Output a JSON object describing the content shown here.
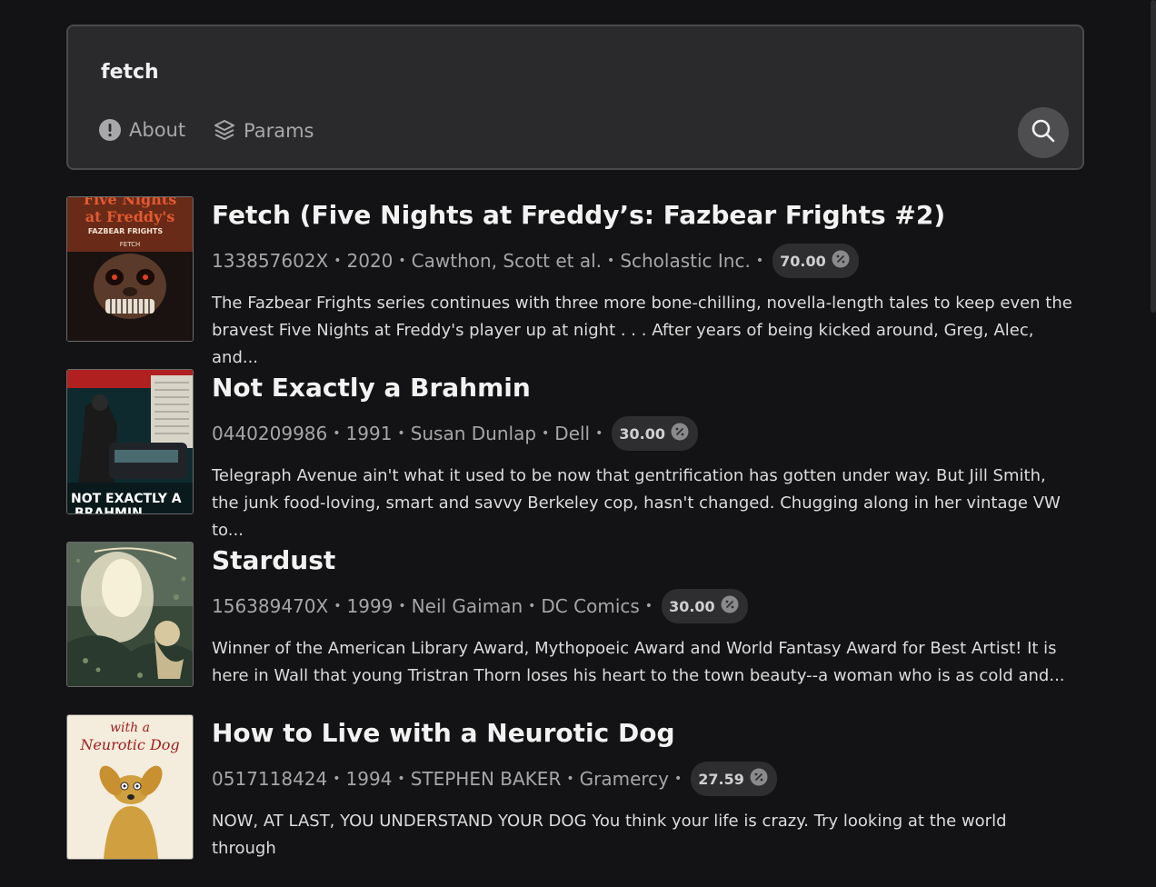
{
  "search": {
    "query": "fetch",
    "about_label": "About",
    "params_label": "Params"
  },
  "icons": {
    "about": "alert-circle-icon",
    "params": "layers-icon",
    "search": "search-icon",
    "price": "discount-badge-icon"
  },
  "results": [
    {
      "title": "Fetch (Five Nights at Freddy’s: Fazbear Frights #2)",
      "isbn": "133857602X",
      "year": "2020",
      "author": "Cawthon, Scott et al.",
      "publisher": "Scholastic Inc.",
      "price": "70.00",
      "description": "The Fazbear Frights series continues with three more bone-chilling, novella-length tales to keep even the bravest Five Nights at Freddy's player up at night . . . After years of being kicked around, Greg, Alec, and...",
      "cover_text": [
        "Five Nights",
        "at Freddy's",
        "FAZBEAR FRIGHTS",
        "FETCH"
      ]
    },
    {
      "title": "Not Exactly a Brahmin",
      "isbn": "0440209986",
      "year": "1991",
      "author": "Susan Dunlap",
      "publisher": "Dell",
      "price": "30.00",
      "description": "Telegraph Avenue ain't what it used to be now that gentrification has gotten under way. But Jill Smith, the junk food-loving, smart and savvy Berkeley cop, hasn't changed. Chugging along in her vintage VW to...",
      "cover_text": [
        "NOT EXACTLY A",
        "BRAHMIN"
      ]
    },
    {
      "title": "Stardust",
      "isbn": "156389470X",
      "year": "1999",
      "author": "Neil Gaiman",
      "publisher": "DC Comics",
      "price": "30.00",
      "description": "Winner of the American Library Award, Mythopoeic Award and World Fantasy Award for Best Artist! It is here in Wall that young Tristran Thorn loses his heart to the town beauty--a woman who is as cold and...",
      "cover_text": []
    },
    {
      "title": "How to Live with a Neurotic Dog",
      "isbn": "0517118424",
      "year": "1994",
      "author": "STEPHEN BAKER",
      "publisher": "Gramercy",
      "price": "27.59",
      "description": "NOW, AT LAST, YOU UNDERSTAND YOUR DOG You think your life is crazy. Try looking at the world through",
      "cover_text": [
        "with a",
        "Neurotic Dog"
      ]
    }
  ],
  "colors": {
    "background": "#131214",
    "search_box": "#2a292c",
    "search_border": "#4a494c",
    "badge": "#2e2d30",
    "muted_text": "#a6a6a8"
  }
}
